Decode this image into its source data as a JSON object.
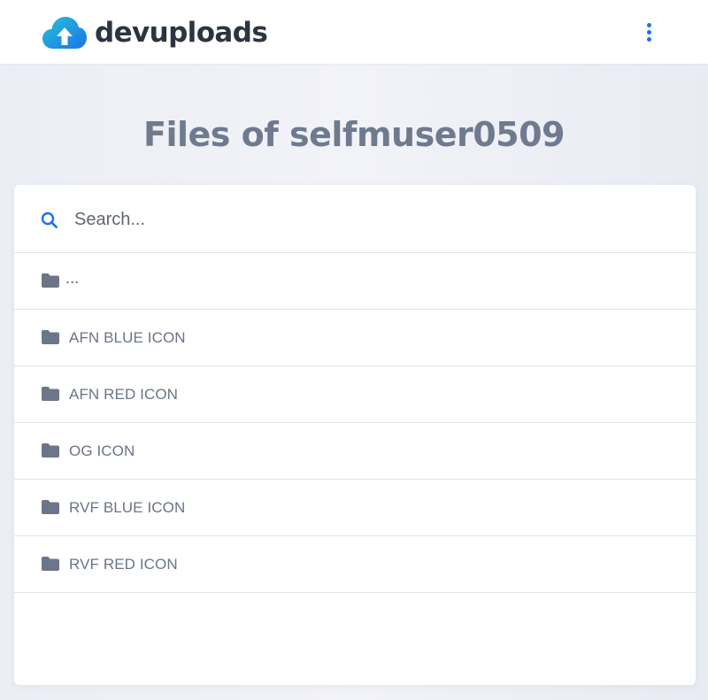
{
  "header": {
    "brand": "devuploads",
    "colors": {
      "logo_primary": "#22b5d6",
      "logo_secondary": "#1a73e8",
      "menu_dots": "#1a73e8"
    },
    "menu_icon": "vertical-ellipsis-icon"
  },
  "page": {
    "title": "Files of selfmuser0509"
  },
  "search": {
    "placeholder": "Search...",
    "value": "",
    "icon": "search-icon"
  },
  "files": {
    "parent_label": "...",
    "items": [
      {
        "label": "AFN BLUE ICON",
        "icon": "folder-icon"
      },
      {
        "label": "AFN RED ICON",
        "icon": "folder-icon"
      },
      {
        "label": "OG ICON",
        "icon": "folder-icon"
      },
      {
        "label": "RVF BLUE ICON",
        "icon": "folder-icon"
      },
      {
        "label": "RVF RED ICON",
        "icon": "folder-icon"
      }
    ]
  }
}
